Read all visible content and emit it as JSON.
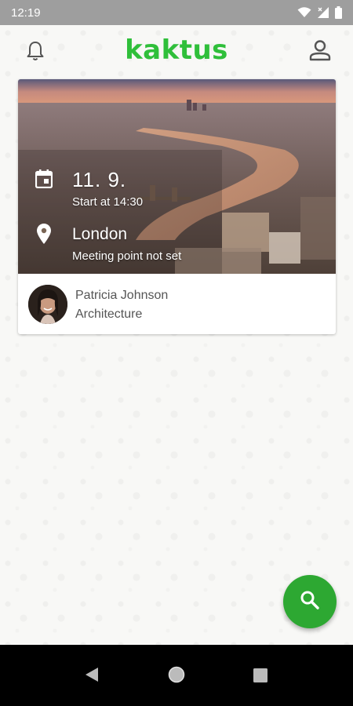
{
  "status_bar": {
    "time": "12:19",
    "icons": [
      "wifi-icon",
      "signal-icon",
      "battery-icon"
    ]
  },
  "app_bar": {
    "logo_text": "kaktus",
    "brand_color": "#2fbf3a",
    "left_icon": "bell-icon",
    "right_icon": "profile-icon"
  },
  "event_card": {
    "date": "11. 9.",
    "start_time": "Start at 14:30",
    "location": "London",
    "meeting_point": "Meeting point not set",
    "person_name": "Patricia Johnson",
    "person_field": "Architecture"
  },
  "fab": {
    "icon": "search-icon",
    "color": "#2da832"
  },
  "nav_bar": {
    "icons": [
      "back-icon",
      "home-icon",
      "recents-icon"
    ]
  }
}
